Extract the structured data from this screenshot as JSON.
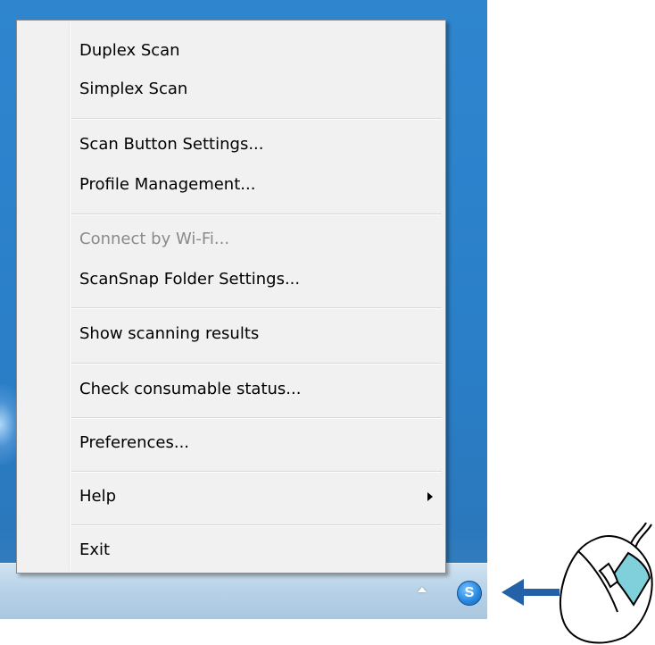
{
  "menu": {
    "groups": [
      [
        {
          "label": "Duplex Scan",
          "enabled": true
        },
        {
          "label": "Simplex Scan",
          "enabled": true
        }
      ],
      [
        {
          "label": "Scan Button Settings...",
          "enabled": true
        },
        {
          "label": "Profile Management...",
          "enabled": true
        }
      ],
      [
        {
          "label": "Connect by Wi-Fi...",
          "enabled": false
        },
        {
          "label": "ScanSnap Folder Settings...",
          "enabled": true
        }
      ],
      [
        {
          "label": "Show scanning results",
          "enabled": true
        }
      ],
      [
        {
          "label": "Check consumable status...",
          "enabled": true
        }
      ],
      [
        {
          "label": "Preferences...",
          "enabled": true
        }
      ],
      [
        {
          "label": "Help",
          "enabled": true,
          "submenu": true
        }
      ],
      [
        {
          "label": "Exit",
          "enabled": true
        }
      ]
    ]
  },
  "taskbar": {
    "tray_icon_glyph": "S",
    "tray_icon_name": "scansnap-manager-icon",
    "overflow_icon_name": "show-hidden-icons-arrow"
  },
  "illustration": {
    "pointer_color": "#2461a8",
    "mouse_button_color": "#7fd0da"
  }
}
